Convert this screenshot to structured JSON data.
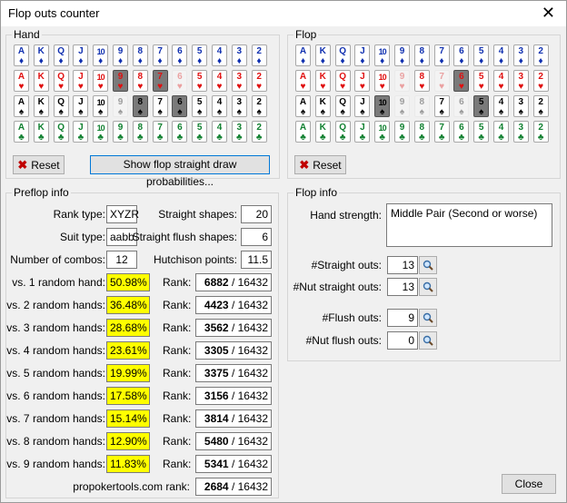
{
  "window": {
    "title": "Flop outs counter"
  },
  "hand_group": {
    "label": "Hand"
  },
  "flop_group": {
    "label": "Flop"
  },
  "preflop_group": {
    "label": "Preflop info"
  },
  "flopinfo_group": {
    "label": "Flop info"
  },
  "ranks": [
    "A",
    "K",
    "Q",
    "J",
    "10",
    "9",
    "8",
    "7",
    "6",
    "5",
    "4",
    "3",
    "2"
  ],
  "suits": [
    {
      "name": "diamonds",
      "symbol": "♦",
      "color": "#1030b0"
    },
    {
      "name": "hearts",
      "symbol": "♥",
      "color": "#e01010"
    },
    {
      "name": "spades",
      "symbol": "♠",
      "color": "#000000"
    },
    {
      "name": "clubs",
      "symbol": "♣",
      "color": "#108030"
    }
  ],
  "hand_selected": [
    "9h",
    "7h",
    "8s",
    "6s"
  ],
  "hand_dimmed": [
    "6h",
    "9s"
  ],
  "flop_selected": [
    "6h",
    "10s",
    "5s"
  ],
  "flop_dimmed": [
    "9h",
    "7h",
    "9s",
    "8s",
    "6s"
  ],
  "buttons": {
    "reset": "Reset",
    "reset_flop": "Reset",
    "straight_draw": "Show flop straight draw probabilities...",
    "close": "Close"
  },
  "preflop": {
    "rank_type_label": "Rank type:",
    "rank_type": "XYZR",
    "suit_type_label": "Suit type:",
    "suit_type": "aabb",
    "combos_label": "Number of combos:",
    "combos": "12",
    "straight_shapes_label": "Straight shapes:",
    "straight_shapes": "20",
    "straight_flush_shapes_label": "Straight flush shapes:",
    "straight_flush_shapes": "6",
    "hutchison_label": "Hutchison points:",
    "hutchison": "11.5",
    "rank_label": "Rank:",
    "rows": [
      {
        "label": "vs. 1 random hand:",
        "pct": "50.98%",
        "rank": "6882",
        "total": "16432"
      },
      {
        "label": "vs. 2 random hands:",
        "pct": "36.48%",
        "rank": "4423",
        "total": "16432"
      },
      {
        "label": "vs. 3 random hands:",
        "pct": "28.68%",
        "rank": "3562",
        "total": "16432"
      },
      {
        "label": "vs. 4 random hands:",
        "pct": "23.61%",
        "rank": "3305",
        "total": "16432"
      },
      {
        "label": "vs. 5 random hands:",
        "pct": "19.99%",
        "rank": "3375",
        "total": "16432"
      },
      {
        "label": "vs. 6 random hands:",
        "pct": "17.58%",
        "rank": "3156",
        "total": "16432"
      },
      {
        "label": "vs. 7 random hands:",
        "pct": "15.14%",
        "rank": "3814",
        "total": "16432"
      },
      {
        "label": "vs. 8 random hands:",
        "pct": "12.90%",
        "rank": "5480",
        "total": "16432"
      },
      {
        "label": "vs. 9 random hands:",
        "pct": "11.83%",
        "rank": "5341",
        "total": "16432"
      }
    ],
    "propoker_label": "propokertools.com rank:",
    "propoker_rank": "2684",
    "propoker_total": "16432"
  },
  "flopinfo": {
    "hand_strength_label": "Hand strength:",
    "hand_strength": "Middle Pair (Second or worse)",
    "straight_outs_label": "#Straight outs:",
    "straight_outs": "13",
    "nut_straight_outs_label": "#Nut straight outs:",
    "nut_straight_outs": "13",
    "flush_outs_label": "#Flush outs:",
    "flush_outs": "9",
    "nut_flush_outs_label": "#Nut flush outs:",
    "nut_flush_outs": "0"
  }
}
